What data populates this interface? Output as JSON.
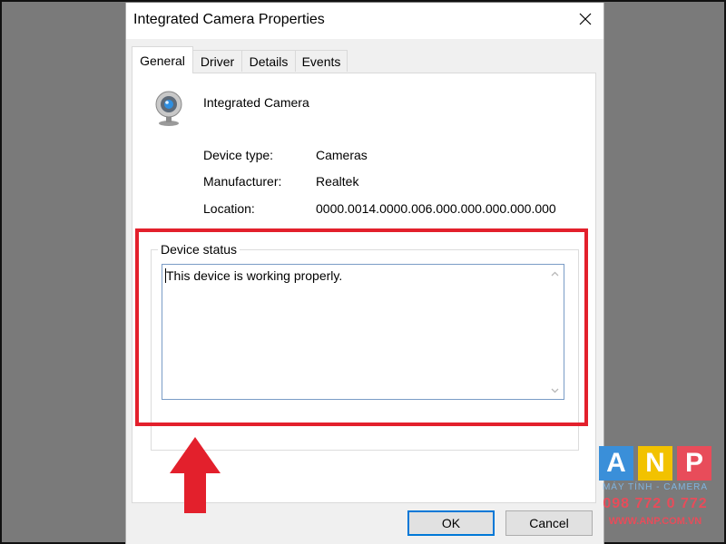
{
  "window": {
    "title": "Integrated Camera Properties",
    "close_icon": "close-icon"
  },
  "tabs": [
    {
      "label": "General",
      "active": true
    },
    {
      "label": "Driver",
      "active": false
    },
    {
      "label": "Details",
      "active": false
    },
    {
      "label": "Events",
      "active": false
    }
  ],
  "device": {
    "icon": "webcam-icon",
    "name": "Integrated Camera",
    "properties": [
      {
        "label": "Device type:",
        "value": "Cameras"
      },
      {
        "label": "Manufacturer:",
        "value": "Realtek"
      },
      {
        "label": "Location:",
        "value": "0000.0014.0000.006.000.000.000.000.000"
      }
    ]
  },
  "device_status": {
    "legend": "Device status",
    "text": "This device is working properly."
  },
  "buttons": {
    "ok": "OK",
    "cancel": "Cancel"
  },
  "annotation": {
    "highlight_color": "#e3202c",
    "arrow_color": "#e3202c"
  },
  "watermark": {
    "letters": [
      "A",
      "N",
      "P"
    ],
    "letter_colors": [
      "#3a8fd9",
      "#f2c200",
      "#e84c5a"
    ],
    "subtitle": "MÁY TÍNH - CAMERA",
    "phone": "098 772 0 772",
    "website": "WWW.ANP.COM.VN"
  }
}
